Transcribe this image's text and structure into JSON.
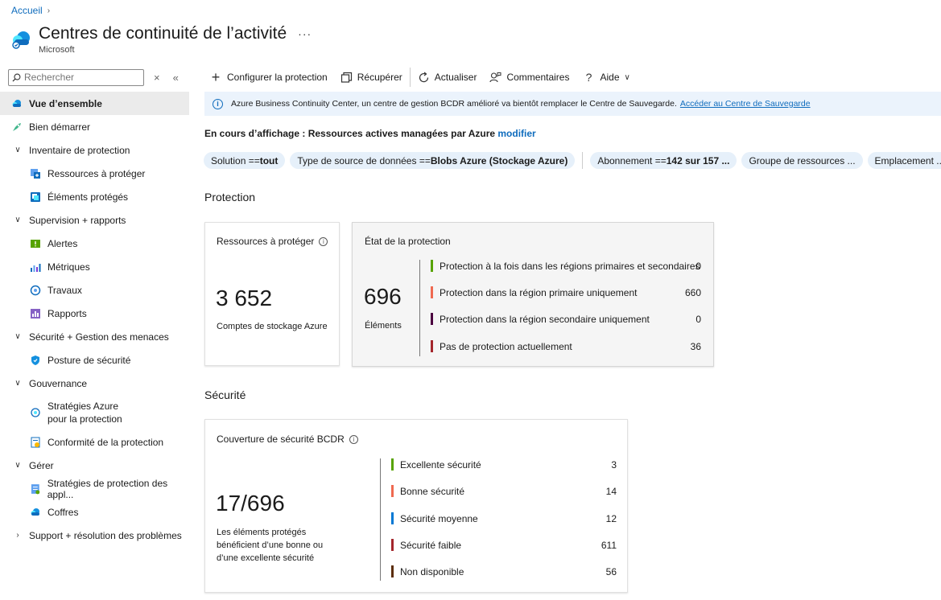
{
  "breadcrumb": {
    "home": "Accueil"
  },
  "header": {
    "title": "Centres de continuité de l’activité",
    "subtitle": "Microsoft",
    "more": "···"
  },
  "sidebar": {
    "search_placeholder": "Rechercher",
    "items": [
      {
        "label": "Vue d’ensemble"
      },
      {
        "label": "Bien démarrer"
      },
      {
        "label": "Inventaire de protection"
      },
      {
        "label": "Ressources à protéger"
      },
      {
        "label": "Éléments protégés"
      },
      {
        "label": "Supervision + rapports"
      },
      {
        "label": "Alertes"
      },
      {
        "label": "Métriques"
      },
      {
        "label": "Travaux"
      },
      {
        "label": "Rapports"
      },
      {
        "label": "Sécurité + Gestion des menaces"
      },
      {
        "label": "Posture de sécurité"
      },
      {
        "label": "Gouvernance"
      },
      {
        "label": "Stratégies Azure",
        "label2": "pour la protection"
      },
      {
        "label": "Conformité de la protection"
      },
      {
        "label": "Gérer"
      },
      {
        "label": "Stratégies de protection des appl..."
      },
      {
        "label": "Coffres"
      },
      {
        "label": "Support + résolution des problèmes"
      }
    ]
  },
  "toolbar": {
    "configure": "Configurer la protection",
    "recover": "Récupérer",
    "refresh": "Actualiser",
    "feedback": "Commentaires",
    "help": "Aide"
  },
  "banner": {
    "text": "Azure Business Continuity Center, un centre de gestion BCDR amélioré va bientôt remplacer le Centre de Sauvegarde.",
    "link": "Accéder au Centre de Sauvegarde"
  },
  "viewing": {
    "prefix": "En cours d’affichage : Ressources actives managées par Azure",
    "link": "modifier"
  },
  "filters": [
    {
      "key": "Solution == ",
      "value": "tout"
    },
    {
      "key": "Type de source de données == ",
      "value": "Blobs Azure (Stockage Azure)"
    },
    {
      "key": "Abonnement == ",
      "value": "142 sur 157 ..."
    },
    {
      "key": "Groupe de ressources ...",
      "value": ""
    },
    {
      "key": "Emplacement ...",
      "value": ""
    }
  ],
  "protection": {
    "section_title": "Protection",
    "resources_card": {
      "title": "Ressources à protéger",
      "value": "3 652",
      "caption": "Comptes de stockage Azure"
    },
    "state_card": {
      "title": "État de la protection",
      "value": "696",
      "caption": "Éléments",
      "rows": [
        {
          "label": "Protection à la fois dans les régions primaires et secondaires",
          "value": "0",
          "color": "#57a300"
        },
        {
          "label": "Protection dans la région primaire uniquement",
          "value": "660",
          "color": "#ef6950"
        },
        {
          "label": "Protection dans la région secondaire uniquement",
          "value": "0",
          "color": "#4b003f"
        },
        {
          "label": "Pas de protection actuellement",
          "value": "36",
          "color": "#a4262c"
        }
      ]
    }
  },
  "security": {
    "section_title": "Sécurité",
    "card": {
      "title": "Couverture de sécurité BCDR",
      "value": "17/696",
      "caption": "Les éléments protégés bénéficient d’une bonne ou d’une excellente sécurité",
      "rows": [
        {
          "label": "Excellente sécurité",
          "value": "3",
          "color": "#57a300"
        },
        {
          "label": "Bonne sécurité",
          "value": "14",
          "color": "#ef6950"
        },
        {
          "label": "Sécurité moyenne",
          "value": "12",
          "color": "#0078d4"
        },
        {
          "label": "Sécurité faible",
          "value": "611",
          "color": "#a4262c"
        },
        {
          "label": "Non disponible",
          "value": "56",
          "color": "#5c2e0a"
        }
      ]
    }
  }
}
